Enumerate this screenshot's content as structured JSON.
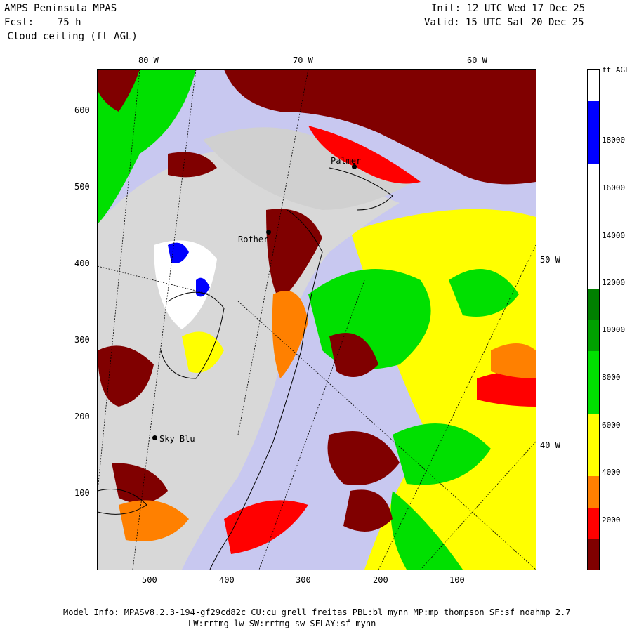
{
  "header": {
    "title_left_1": "AMPS Peninsula MPAS",
    "title_left_2": "Fcst:    75 h",
    "title_left_3": " Cloud ceiling (ft AGL)",
    "init": "Init: 12 UTC Wed 17 Dec 25",
    "valid": "Valid: 15 UTC Sat 20 Dec 25"
  },
  "map": {
    "top_longitudes": [
      "80 W",
      "70 W",
      "60 W"
    ],
    "right_longitudes": [
      "50 W",
      "40 W"
    ],
    "y_ticks": [
      "600",
      "500",
      "400",
      "300",
      "200",
      "100"
    ],
    "x_ticks": [
      "500",
      "400",
      "300",
      "200",
      "100"
    ],
    "stations": [
      {
        "label": "Palmer"
      },
      {
        "label": "Rother"
      },
      {
        "label": "Sky Blu"
      }
    ]
  },
  "legend": {
    "unit": "ft AGL",
    "labels": [
      "18000",
      "16000",
      "14000",
      "12000",
      "10000",
      "8000",
      "6000",
      "4000",
      "2000"
    ],
    "colors": [
      "#800000",
      "#ff0000",
      "#ff8000",
      "#ffff00",
      "#ffff00",
      "#00e000",
      "#00e000",
      "#00a000",
      "#008000",
      "#ffffff",
      "#ffffff",
      "#ffffff",
      "#ffffff",
      "#0000ff",
      "#0000ff",
      "#ffffff"
    ]
  },
  "footer": {
    "line1": "Model Info: MPASv8.2.3-194-gf29cd82c CU:cu_grell_freitas PBL:bl_mynn MP:mp_thompson SF:sf_noahmp 2.7",
    "line2": "LW:rrtmg_lw SW:rrtmg_sw SFLAY:sf_mynn"
  }
}
